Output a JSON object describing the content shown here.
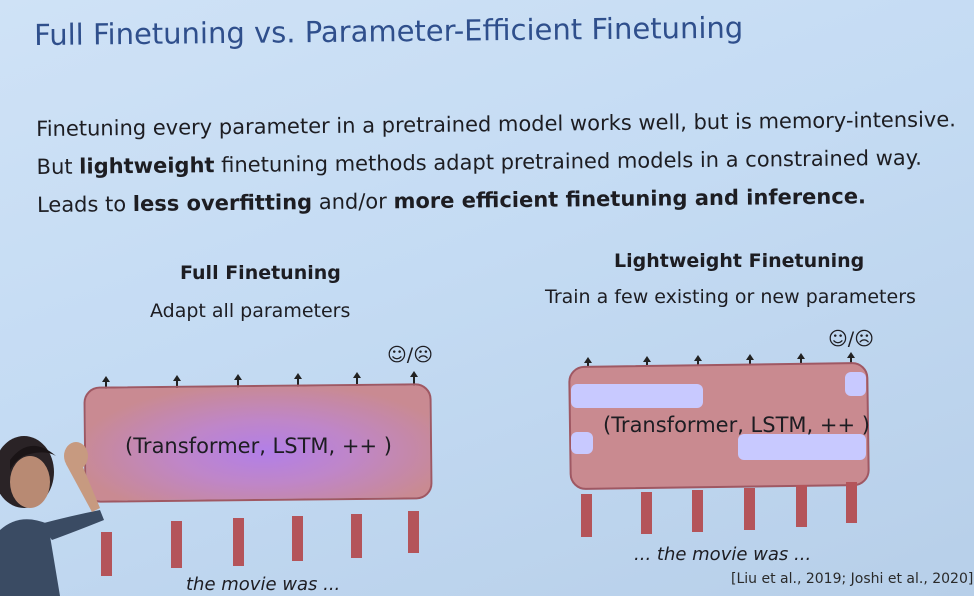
{
  "slide": {
    "title": "Full Finetuning vs. Parameter-Efficient Finetuning",
    "bullets": [
      {
        "plain": "Finetuning every parameter in a pretrained model works well, but is memory-intensive."
      },
      {
        "pre": "But ",
        "bold": "lightweight",
        "post": " finetuning methods adapt pretrained models in a constrained way."
      },
      {
        "pre": "Leads to ",
        "bold1": "less overfitting",
        "mid": " and/or ",
        "bold2": "more efficient finetuning and inference."
      }
    ]
  },
  "full": {
    "heading": "Full Finetuning",
    "subtitle": "Adapt all parameters",
    "face": "☺/☹",
    "model_label": "(Transformer, LSTM, ++ )",
    "caption": "the movie was ..."
  },
  "light": {
    "heading": "Lightweight Finetuning",
    "subtitle": "Train a few existing or new parameters",
    "face": "☺/☹",
    "model_label": "(Transformer, LSTM, ++ )",
    "caption": "... the movie was ..."
  },
  "citation": "[Liu et al., 2019; Joshi et al., 2020]",
  "colors": {
    "title": "#2f4f8c",
    "model_fill": "#c98a90",
    "model_highlight": "#b27fe8",
    "adapter_fill": "#c8c9ff",
    "token_bar": "#b4545a"
  }
}
